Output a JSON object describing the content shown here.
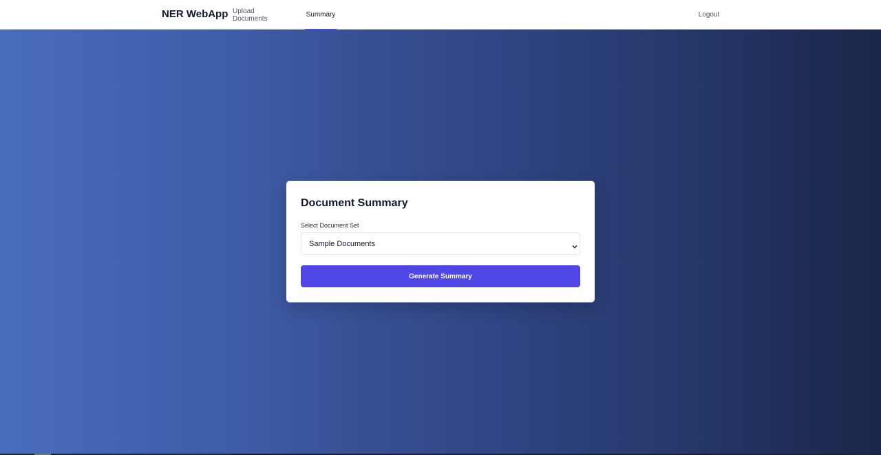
{
  "nav": {
    "brand": "NER WebApp",
    "links": [
      {
        "label": "Upload Documents",
        "active": false
      },
      {
        "label": "Summary",
        "active": true
      }
    ],
    "logout_label": "Logout",
    "active_indicator_color": "#4f46e5"
  },
  "card": {
    "title": "Document Summary",
    "select_label": "Select Document Set",
    "select_value": "Sample Documents",
    "select_icon": "chevron-down-icon",
    "button_label": "Generate Summary",
    "button_color": "#4f46e5"
  },
  "background": {
    "gradient_start": "#4a6cbd",
    "gradient_end": "#1a2649"
  }
}
